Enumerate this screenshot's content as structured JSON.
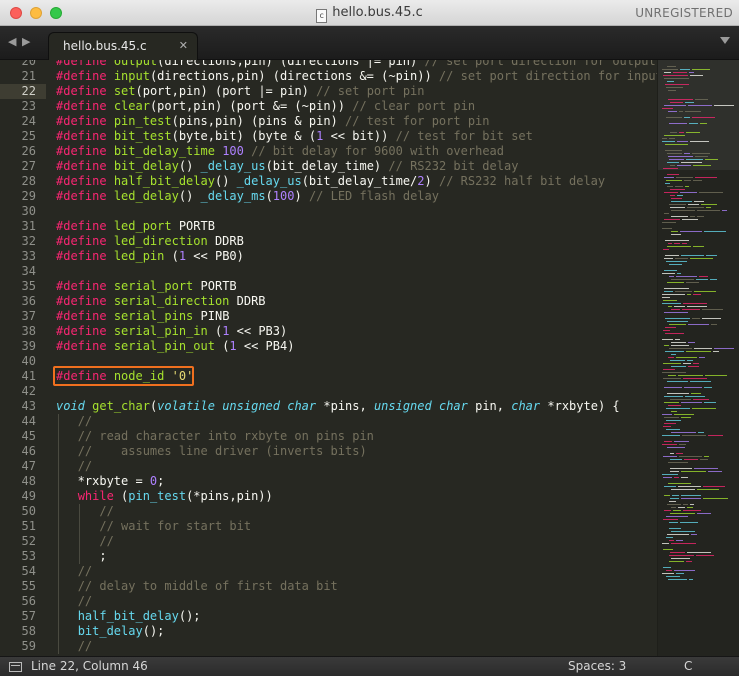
{
  "window": {
    "title": "hello.bus.45.c",
    "file_icon_letter": "c",
    "license": "UNREGISTERED"
  },
  "tabbar": {
    "nav_left": "◀",
    "nav_right": "▶",
    "active_tab": "hello.bus.45.c",
    "close_glyph": "✕"
  },
  "editor": {
    "current_line": 22,
    "highlighted_line": 41,
    "lines": [
      {
        "n": 20,
        "html": "<span class=\"kw\">#define</span> <span class=\"fn\">output</span>(directions,pin) (directions |= pin) <span class=\"cm\">// set port direction for output</span>"
      },
      {
        "n": 21,
        "html": "<span class=\"kw\">#define</span> <span class=\"fn\">input</span>(directions,pin) (directions &amp;= (~pin)) <span class=\"cm\">// set port direction for input</span>"
      },
      {
        "n": 22,
        "html": "<span class=\"kw\">#define</span> <span class=\"fn\">set</span>(port,pin) (port |= pin) <span class=\"cm\">// set port pin</span>"
      },
      {
        "n": 23,
        "html": "<span class=\"kw\">#define</span> <span class=\"fn\">clear</span>(port,pin) (port &amp;= (~pin)) <span class=\"cm\">// clear port pin</span>"
      },
      {
        "n": 24,
        "html": "<span class=\"kw\">#define</span> <span class=\"fn\">pin_test</span>(pins,pin) (pins &amp; pin) <span class=\"cm\">// test for port pin</span>"
      },
      {
        "n": 25,
        "html": "<span class=\"kw\">#define</span> <span class=\"fn\">bit_test</span>(byte,bit) (byte &amp; (<span class=\"num\">1</span> &lt;&lt; bit)) <span class=\"cm\">// test for bit set</span>"
      },
      {
        "n": 26,
        "html": "<span class=\"kw\">#define</span> <span class=\"fn\">bit_delay_time</span> <span class=\"num\">100</span> <span class=\"cm\">// bit delay for 9600 with overhead</span>"
      },
      {
        "n": 27,
        "html": "<span class=\"kw\">#define</span> <span class=\"fn\">bit_delay</span>() <span class=\"tyb\">_delay_us</span>(bit_delay_time) <span class=\"cm\">// RS232 bit delay</span>"
      },
      {
        "n": 28,
        "html": "<span class=\"kw\">#define</span> <span class=\"fn\">half_bit_delay</span>() <span class=\"tyb\">_delay_us</span>(bit_delay_time/<span class=\"num\">2</span>) <span class=\"cm\">// RS232 half bit delay</span>"
      },
      {
        "n": 29,
        "html": "<span class=\"kw\">#define</span> <span class=\"fn\">led_delay</span>() <span class=\"tyb\">_delay_ms</span>(<span class=\"num\">100</span>) <span class=\"cm\">// LED flash delay</span>"
      },
      {
        "n": 30,
        "html": ""
      },
      {
        "n": 31,
        "html": "<span class=\"kw\">#define</span> <span class=\"fn\">led_port</span> PORTB"
      },
      {
        "n": 32,
        "html": "<span class=\"kw\">#define</span> <span class=\"fn\">led_direction</span> DDRB"
      },
      {
        "n": 33,
        "html": "<span class=\"kw\">#define</span> <span class=\"fn\">led_pin</span> (<span class=\"num\">1</span> &lt;&lt; PB0)"
      },
      {
        "n": 34,
        "html": ""
      },
      {
        "n": 35,
        "html": "<span class=\"kw\">#define</span> <span class=\"fn\">serial_port</span> PORTB"
      },
      {
        "n": 36,
        "html": "<span class=\"kw\">#define</span> <span class=\"fn\">serial_direction</span> DDRB"
      },
      {
        "n": 37,
        "html": "<span class=\"kw\">#define</span> <span class=\"fn\">serial_pins</span> PINB"
      },
      {
        "n": 38,
        "html": "<span class=\"kw\">#define</span> <span class=\"fn\">serial_pin_in</span> (<span class=\"num\">1</span> &lt;&lt; PB3)"
      },
      {
        "n": 39,
        "html": "<span class=\"kw\">#define</span> <span class=\"fn\">serial_pin_out</span> (<span class=\"num\">1</span> &lt;&lt; PB4)"
      },
      {
        "n": 40,
        "html": ""
      },
      {
        "n": 41,
        "html": "<span class=\"kw\">#define</span> <span class=\"fn\">node_id</span> <span class=\"str\">'0'</span>"
      },
      {
        "n": 42,
        "html": ""
      },
      {
        "n": 43,
        "html": "<span class=\"ty\">void</span> <span class=\"fn\">get_char</span>(<span class=\"ty\">volatile</span> <span class=\"ty\">unsigned</span> <span class=\"ty\">char</span> *pins, <span class=\"ty\">unsigned</span> <span class=\"ty\">char</span> pin, <span class=\"ty\">char</span> *rxbyte) {"
      },
      {
        "n": 44,
        "html": "   <span class=\"cm\">//</span>"
      },
      {
        "n": 45,
        "html": "   <span class=\"cm\">// read character into rxbyte on pins pin</span>"
      },
      {
        "n": 46,
        "html": "   <span class=\"cm\">//    assumes line driver (inverts bits)</span>"
      },
      {
        "n": 47,
        "html": "   <span class=\"cm\">//</span>"
      },
      {
        "n": 48,
        "html": "   *rxbyte = <span class=\"num\">0</span>;"
      },
      {
        "n": 49,
        "html": "   <span class=\"kw\">while</span> (<span class=\"tyb\">pin_test</span>(*pins,pin))"
      },
      {
        "n": 50,
        "html": "      <span class=\"cm\">//</span>"
      },
      {
        "n": 51,
        "html": "      <span class=\"cm\">// wait for start bit</span>"
      },
      {
        "n": 52,
        "html": "      <span class=\"cm\">//</span>"
      },
      {
        "n": 53,
        "html": "      ;"
      },
      {
        "n": 54,
        "html": "   <span class=\"cm\">//</span>"
      },
      {
        "n": 55,
        "html": "   <span class=\"cm\">// delay to middle of first data bit</span>"
      },
      {
        "n": 56,
        "html": "   <span class=\"cm\">//</span>"
      },
      {
        "n": 57,
        "html": "   <span class=\"tyb\">half_bit_delay</span>();"
      },
      {
        "n": 58,
        "html": "   <span class=\"tyb\">bit_delay</span>();"
      },
      {
        "n": 59,
        "html": "   <span class=\"cm\">//</span>"
      }
    ]
  },
  "statusbar": {
    "position": "Line 22, Column 46",
    "indentation": "Spaces: 3",
    "syntax": "C"
  },
  "colors": {
    "background": "#272822",
    "keyword": "#f92672",
    "function": "#a6e22e",
    "number": "#ae81ff",
    "comment": "#75715e",
    "string": "#e6db74",
    "type": "#66d9ef",
    "highlight_box": "#f0701f"
  }
}
